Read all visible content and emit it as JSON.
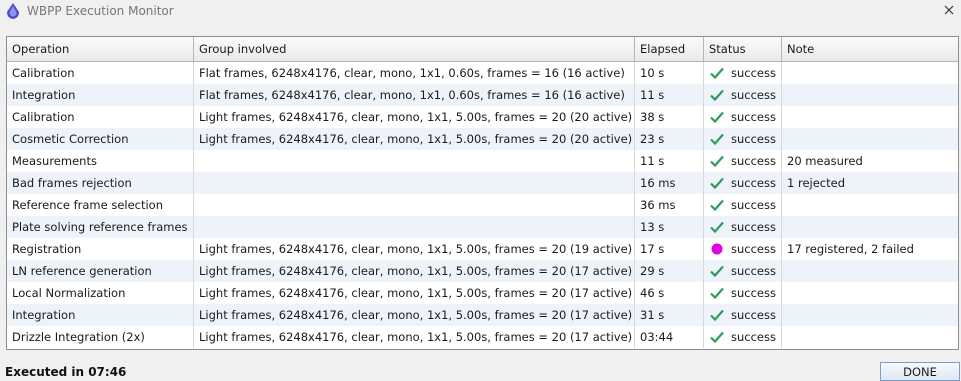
{
  "window": {
    "title": "WBPP Execution Monitor",
    "icon": "pixinsight-logo-icon"
  },
  "table": {
    "headers": [
      "Operation",
      "Group involved",
      "Elapsed",
      "Status",
      "Note"
    ],
    "rows": [
      {
        "operation": "Calibration",
        "group": "Flat frames, 6248x4176, clear, mono, 1x1, 0.60s, frames = 16 (16 active)",
        "elapsed": "10 s",
        "status": "success",
        "status_icon": "check-icon",
        "note": ""
      },
      {
        "operation": "Integration",
        "group": "Flat frames, 6248x4176, clear, mono, 1x1, 0.60s, frames = 16 (16 active)",
        "elapsed": "11 s",
        "status": "success",
        "status_icon": "check-icon",
        "note": ""
      },
      {
        "operation": "Calibration",
        "group": "Light frames, 6248x4176, clear, mono, 1x1, 5.00s, frames = 20 (20 active)",
        "elapsed": "38 s",
        "status": "success",
        "status_icon": "check-icon",
        "note": ""
      },
      {
        "operation": "Cosmetic Correction",
        "group": "Light frames, 6248x4176, clear, mono, 1x1, 5.00s, frames = 20 (20 active)",
        "elapsed": "23 s",
        "status": "success",
        "status_icon": "check-icon",
        "note": ""
      },
      {
        "operation": "Measurements",
        "group": "",
        "elapsed": "11 s",
        "status": "success",
        "status_icon": "check-icon",
        "note": "20 measured"
      },
      {
        "operation": "Bad frames rejection",
        "group": "",
        "elapsed": "16 ms",
        "status": "success",
        "status_icon": "check-icon",
        "note": "1 rejected"
      },
      {
        "operation": "Reference frame selection",
        "group": "",
        "elapsed": "36 ms",
        "status": "success",
        "status_icon": "check-icon",
        "note": ""
      },
      {
        "operation": "Plate solving reference frames",
        "group": "",
        "elapsed": "13 s",
        "status": "success",
        "status_icon": "check-icon",
        "note": ""
      },
      {
        "operation": "Registration",
        "group": "Light frames, 6248x4176, clear, mono, 1x1, 5.00s, frames = 20 (19 active)",
        "elapsed": "17 s",
        "status": "success",
        "status_icon": "warning-dot-icon",
        "note": "17 registered, 2 failed"
      },
      {
        "operation": "LN reference generation",
        "group": "Light frames, 6248x4176, clear, mono, 1x1, 5.00s, frames = 20 (17 active)",
        "elapsed": "29 s",
        "status": "success",
        "status_icon": "check-icon",
        "note": ""
      },
      {
        "operation": "Local Normalization",
        "group": "Light frames, 6248x4176, clear, mono, 1x1, 5.00s, frames = 20 (17 active)",
        "elapsed": "46 s",
        "status": "success",
        "status_icon": "check-icon",
        "note": ""
      },
      {
        "operation": "Integration",
        "group": "Light frames, 6248x4176, clear, mono, 1x1, 5.00s, frames = 20 (17 active)",
        "elapsed": "31 s",
        "status": "success",
        "status_icon": "check-icon",
        "note": ""
      },
      {
        "operation": "Drizzle Integration (2x)",
        "group": "Light frames, 6248x4176, clear, mono, 1x1, 5.00s, frames = 20 (17 active)",
        "elapsed": "03:44",
        "status": "success",
        "status_icon": "check-icon",
        "note": ""
      }
    ]
  },
  "footer": {
    "executed_text": "Executed in 07:46",
    "done_label": "DONE"
  },
  "colors": {
    "check": "#2a9d5c",
    "warning_dot": "#e000e0",
    "row_alt": "#eef3fa",
    "logo": "#4a4fc9"
  }
}
